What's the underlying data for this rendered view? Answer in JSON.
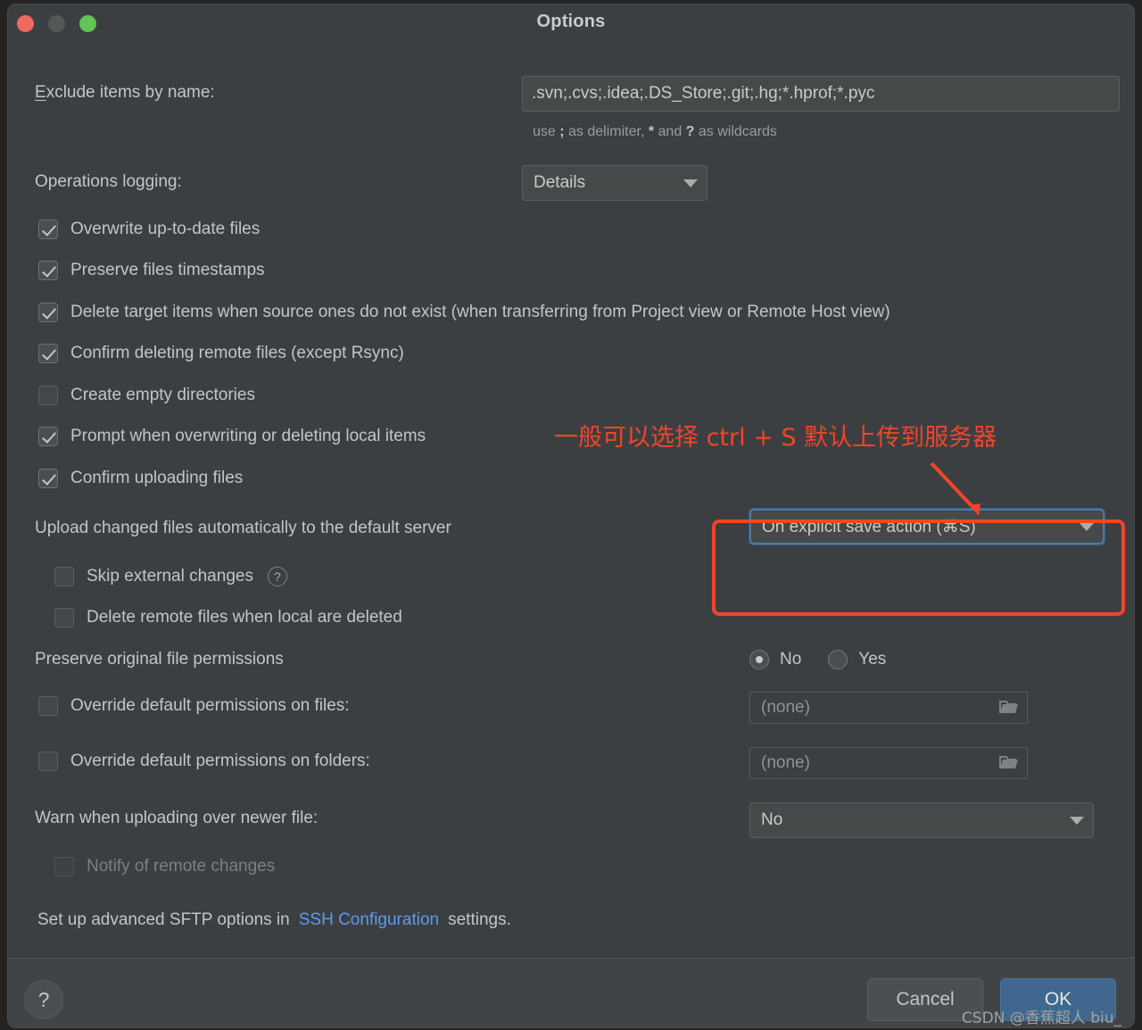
{
  "window": {
    "title": "Options",
    "traffic_lights": [
      "close",
      "minimize",
      "maximize"
    ]
  },
  "form": {
    "exclude_label": "Exclude items by name:",
    "exclude_value": ".svn;.cvs;.idea;.DS_Store;.git;.hg;*.hprof;*.pyc",
    "exclude_hint_prefix": "use ",
    "exclude_hint_semicolon": ";",
    "exclude_hint_mid": " as delimiter, ",
    "exclude_hint_star": "*",
    "exclude_hint_and": " and ",
    "exclude_hint_question": "?",
    "exclude_hint_suffix": " as wildcards",
    "operations_logging_label": "Operations logging:",
    "operations_logging_value": "Details"
  },
  "checkboxes": [
    {
      "label": "Overwrite up-to-date files",
      "checked": true,
      "enabled": true
    },
    {
      "label": "Preserve files timestamps",
      "checked": true,
      "enabled": true
    },
    {
      "label": "Delete target items when source ones do not exist (when transferring from Project view or Remote Host view)",
      "checked": true,
      "enabled": true
    },
    {
      "label": "Confirm deleting remote files (except Rsync)",
      "checked": true,
      "enabled": true
    },
    {
      "label": "Create empty directories",
      "checked": false,
      "enabled": true
    },
    {
      "label": "Prompt when overwriting or deleting local items",
      "checked": true,
      "enabled": true
    },
    {
      "label": "Confirm uploading files",
      "checked": true,
      "enabled": true
    }
  ],
  "upload": {
    "label": "Upload changed files automatically to the default server",
    "value": "On explicit save action (⌘S)",
    "skip_external_label": "Skip external changes",
    "skip_external_checked": false,
    "skip_external_help": "?",
    "delete_remote_label": "Delete remote files when local are deleted",
    "delete_remote_checked": false
  },
  "permissions": {
    "preserve_label": "Preserve original file permissions",
    "radio_no": "No",
    "radio_yes": "Yes",
    "radio_selected": "No",
    "override_files_label": "Override default permissions on files:",
    "override_files_checked": false,
    "override_files_value": "(none)",
    "override_folders_label": "Override default permissions on folders:",
    "override_folders_checked": false,
    "override_folders_value": "(none)"
  },
  "warn": {
    "label": "Warn when uploading over newer file:",
    "value": "No",
    "notify_label": "Notify of remote changes",
    "notify_checked": false,
    "notify_enabled": false
  },
  "advanced": {
    "prefix": "Set up advanced SFTP options in",
    "link": "SSH Configuration",
    "suffix": "settings."
  },
  "annotation": {
    "text": "一般可以选择 ctrl + S 默认上传到服务器",
    "color": "#f0452a"
  },
  "footer": {
    "help": "?",
    "cancel": "Cancel",
    "ok": "OK"
  },
  "watermark": "CSDN @香蕉超人 biu_"
}
